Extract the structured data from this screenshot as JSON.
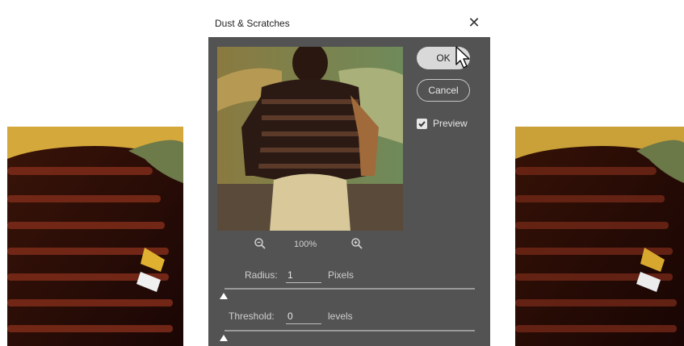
{
  "dialog": {
    "title": "Dust & Scratches",
    "close_glyph": "✕",
    "ok_label": "OK",
    "cancel_label": "Cancel",
    "preview_label": "Preview",
    "preview_checked": true,
    "zoom_level": "100%",
    "radius": {
      "label": "Radius:",
      "value": "1",
      "unit": "Pixels"
    },
    "threshold": {
      "label": "Threshold:",
      "value": "0",
      "unit": "levels"
    }
  },
  "icons": {
    "zoom_out": "zoom-out-icon",
    "zoom_in": "zoom-in-icon",
    "cursor": "pointer-cursor-icon",
    "checkbox": "checkmark-icon"
  },
  "colors": {
    "dialog_bg": "#535353",
    "ok_bg": "#d9d9d9"
  }
}
